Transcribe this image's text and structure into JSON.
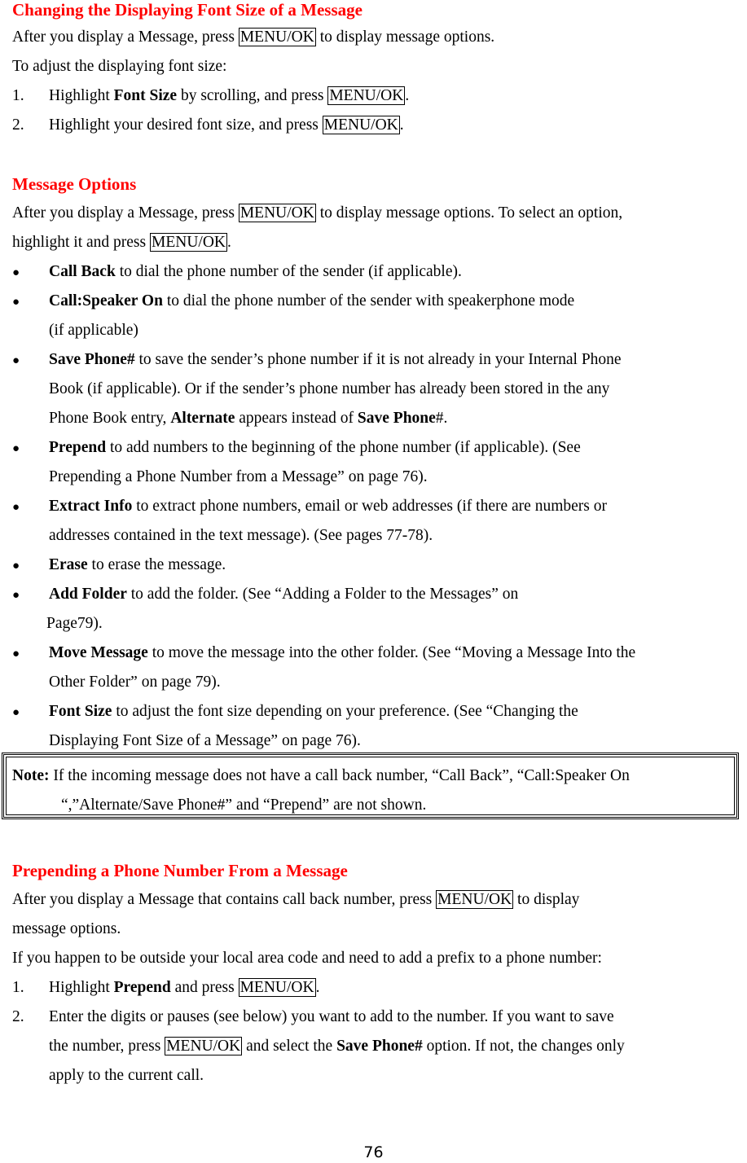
{
  "key_label": "MENU/OK",
  "sec1": {
    "heading": "Changing the Displaying Font Size of a Message",
    "p1_a": "After you display a Message, press ",
    "p1_b": " to display message options.",
    "p2": "To adjust the displaying font size:",
    "steps": [
      {
        "num": "1.",
        "a": "Highlight ",
        "bold": "Font Size",
        "b": " by scrolling, and press ",
        "c": "."
      },
      {
        "num": "2.",
        "a": "Highlight your desired font size, and press ",
        "c": "."
      }
    ]
  },
  "sec2": {
    "heading": "Message Options",
    "p1_a": "After you display a Message, press ",
    "p1_b": " to display message options. To select an option,",
    "p2_a": "highlight it and press ",
    "p2_b": ".",
    "items": [
      {
        "bold": "Call Back",
        "lines": [
          " to dial the phone number of the sender (if applicable)."
        ]
      },
      {
        "bold": "Call:Speaker On",
        "lines": [
          " to dial the phone number of the sender with speakerphone mode",
          "(if applicable)"
        ]
      },
      {
        "bold": "Save Phone#",
        "lines": [
          " to save the sender’s phone number if it is not already in your Internal Phone",
          "Book (if applicable). Or if the sender’s phone number has already been stored in the any"
        ],
        "l3_a": "Phone Book entry, ",
        "l3_bold1": "Alternate",
        "l3_b": " appears instead of ",
        "l3_bold2": "Save Phone",
        "l3_c": "#."
      },
      {
        "bold": "Prepend",
        "lines": [
          " to add numbers to the beginning of the phone number (if applicable). (See",
          "Prepending a Phone Number from a Message” on page 76)."
        ]
      },
      {
        "bold": "Extract Info",
        "lines": [
          " to extract phone numbers, email or web addresses (if there are numbers or",
          "addresses contained in the text message). (See pages 77-78)."
        ]
      },
      {
        "bold": "Erase",
        "lines": [
          " to erase the message."
        ]
      },
      {
        "bold": "Add Folder",
        "lines": [
          " to add the folder. (See “Adding a Folder to the Messages” on",
          "Page79)."
        ]
      },
      {
        "bold": "Move Message",
        "lines": [
          " to move the message into the other folder. (See “Moving a Message Into the",
          "Other Folder” on page 79)."
        ]
      },
      {
        "bold": "Font Size",
        "lines": [
          " to adjust the font size depending on your preference. (See “Changing the",
          "Displaying Font Size of a Message” on page 76)."
        ]
      }
    ],
    "note": {
      "label": "Note:",
      "line1": " If the incoming message does not have a call back number, “Call Back”, “Call:Speaker On",
      "line2": "“,”Alternate/Save Phone#” and “Prepend” are not shown."
    }
  },
  "sec3": {
    "heading": "Prepending a Phone Number From a Message",
    "p1_a": "After you display a Message that contains call back number, press ",
    "p1_b": " to display",
    "p1_c": "message options.",
    "p2": "If you happen to be outside your local area code and need to add a prefix to a phone number:",
    "step1": {
      "num": "1.",
      "a": "Highlight ",
      "bold": "Prepend",
      "b": " and press ",
      "c": "."
    },
    "step2": {
      "num": "2.",
      "l1": "Enter the digits or pauses (see below) you want to add to the number. If you want to save",
      "l2_a": "the number, press ",
      "l2_b": " and select the ",
      "l2_bold": "Save Phone#",
      "l2_c": " option. If not, the changes only",
      "l3": "apply to the current call."
    }
  },
  "page_number": "76"
}
